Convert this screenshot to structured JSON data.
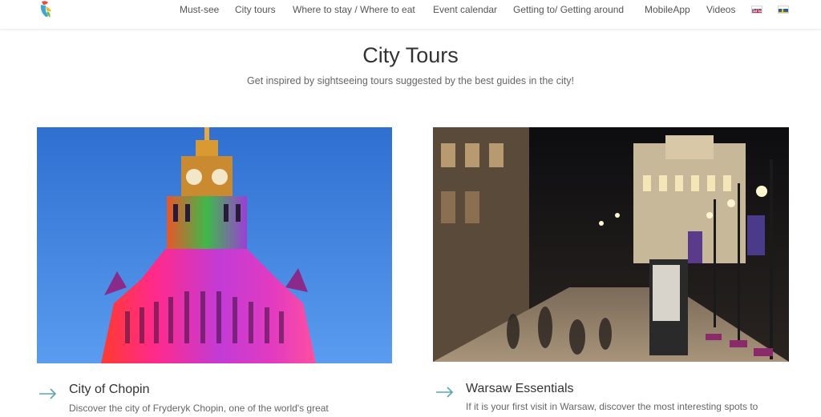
{
  "header": {
    "nav": [
      {
        "label": "Must-see"
      },
      {
        "label": "City tours"
      },
      {
        "label": "Where to stay / Where to eat"
      },
      {
        "label": "Event calendar"
      },
      {
        "label": "Getting to/ Getting around"
      },
      {
        "label": "MobileApp"
      },
      {
        "label": "Videos"
      }
    ],
    "languages": [
      "english-flag",
      "swedish-flag"
    ]
  },
  "page": {
    "title": "City Tours",
    "subtitle": "Get inspired by sightseeing tours suggested by the best guides in the city!"
  },
  "tours": [
    {
      "title": "City of Chopin",
      "description": "Discover the city of Fryderyk Chopin, one of the world's great",
      "image": "palace-of-culture-illuminated"
    },
    {
      "title": "Warsaw Essentials",
      "description": "If it is your first visit in Warsaw, discover the most interesting spots to",
      "image": "warsaw-street-at-night"
    }
  ],
  "colors": {
    "arrow": "#5aa5b5",
    "sky": "#3f7fd6"
  }
}
